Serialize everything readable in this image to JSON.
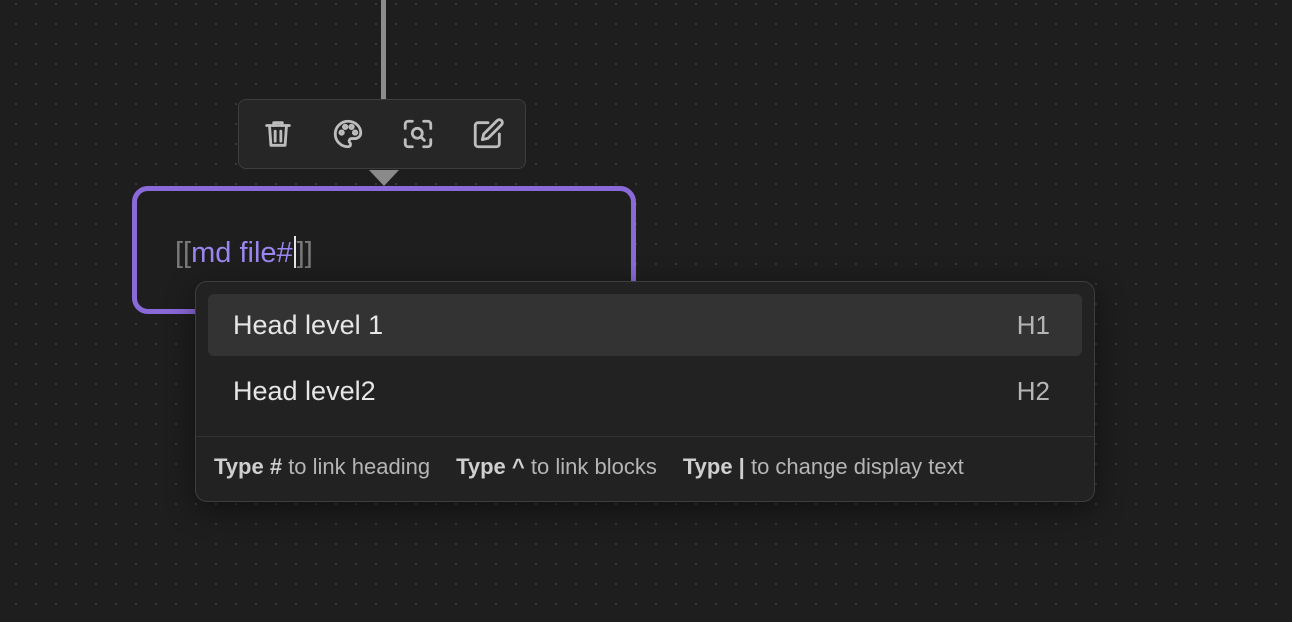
{
  "canvas": {
    "connector": "edge-line"
  },
  "toolbar": {
    "buttons": [
      {
        "name": "delete",
        "icon": "trash-icon"
      },
      {
        "name": "color",
        "icon": "palette-icon"
      },
      {
        "name": "zoom",
        "icon": "zoom-to-fit-icon"
      },
      {
        "name": "edit",
        "icon": "edit-icon"
      }
    ]
  },
  "card": {
    "open_brackets": "[[",
    "link_text": "md file#",
    "close_brackets": "]]",
    "border_color": "#8a6ad9",
    "link_color": "#9b85ee"
  },
  "suggestions": {
    "items": [
      {
        "label": "Head level 1",
        "hint": "H1",
        "selected": true
      },
      {
        "label": "Head level2",
        "hint": "H2",
        "selected": false
      }
    ],
    "footer": [
      {
        "key": "Type #",
        "text": "to link heading"
      },
      {
        "key": "Type ^",
        "text": "to link blocks"
      },
      {
        "key": "Type |",
        "text": "to change display text"
      }
    ]
  }
}
